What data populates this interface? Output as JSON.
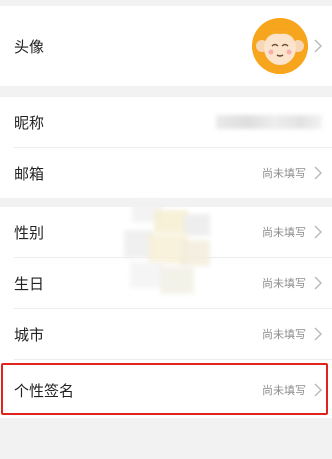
{
  "profile": {
    "avatar": {
      "label": "头像"
    },
    "nickname": {
      "label": "昵称"
    },
    "email": {
      "label": "邮箱",
      "value": "尚未填写"
    },
    "gender": {
      "label": "性别",
      "value": "尚未填写"
    },
    "birthday": {
      "label": "生日",
      "value": "尚未填写"
    },
    "city": {
      "label": "城市",
      "value": "尚未填写"
    },
    "signature": {
      "label": "个性签名",
      "value": "尚未填写"
    }
  },
  "colors": {
    "background": "#f2f2f2",
    "card": "#ffffff",
    "highlight_border": "#e0241b",
    "avatar_bg": "#f9a825"
  }
}
